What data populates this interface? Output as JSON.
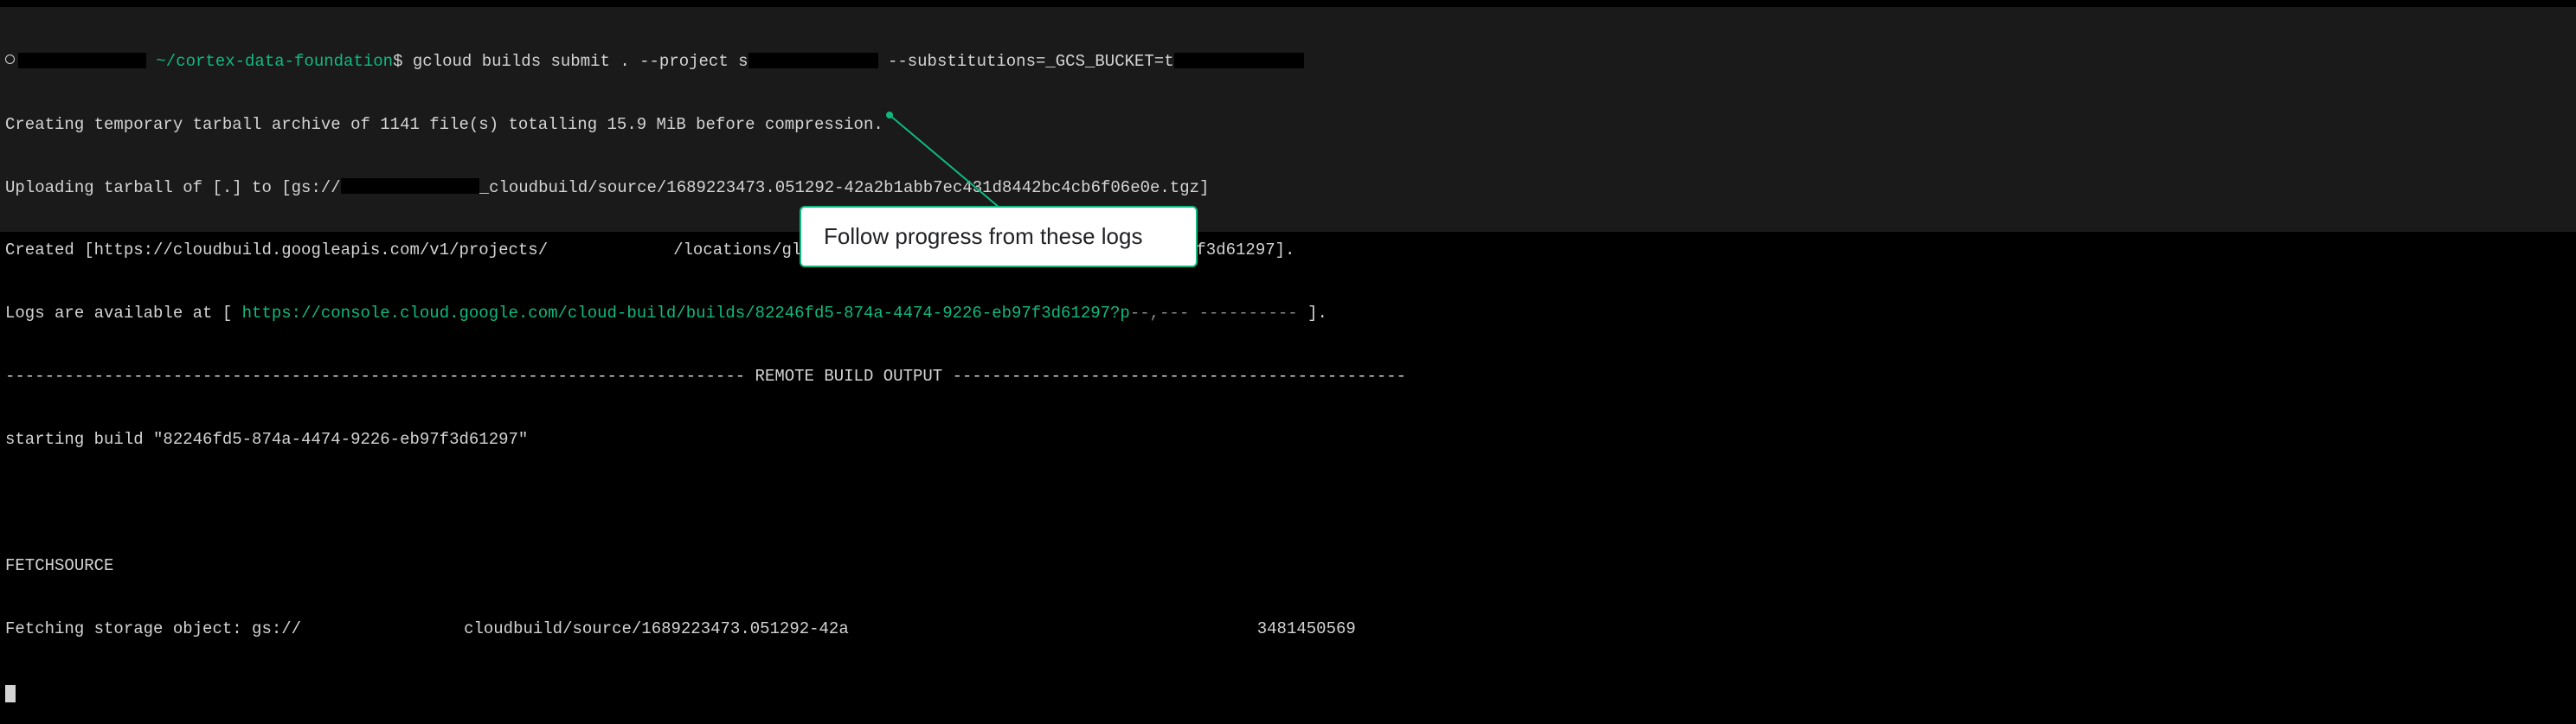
{
  "prompt": {
    "path": "~/cortex-data-foundation",
    "dollar": "$",
    "command_prefix": "gcloud builds submit . --project s",
    "command_suffix_1": " --substitutions=_GCS_BUCKET=t",
    "command_suffix_2": ""
  },
  "output": {
    "line_tarball": "Creating temporary tarball archive of 1141 file(s) totalling 15.9 MiB before compression.",
    "line_upload_prefix": "Uploading tarball of [.] to [gs://",
    "line_upload_suffix": "_cloudbuild/source/1689223473.051292-42a2b1abb7ec431d8442bc4cb6f06e0e.tgz]",
    "line_created_prefix": "Created [https://cloudbuild.googleapis.com/v1/projects/",
    "line_created_suffix": "/locations/global/builds/82246fd5-874a-4474-9226-eb97f3d61297].",
    "line_logs_prefix": "Logs are available at [ ",
    "line_logs_link": "https://console.cloud.google.com/cloud-build/builds/82246fd5-874a-4474-9226-eb97f3d61297?p",
    "line_logs_suffix": " ].",
    "divider_label": " REMOTE BUILD OUTPUT ",
    "line_starting": "starting build \"82246fd5-874a-4474-9226-eb97f3d61297\"",
    "line_fetchsource": "FETCHSOURCE",
    "line_fetching_prefix": "Fetching storage object: gs://",
    "line_fetching_mid": "cloudbuild/source/1689223473.051292-42a",
    "line_fetching_tail": "3481450569"
  },
  "callout": {
    "text": "Follow progress from these logs"
  }
}
